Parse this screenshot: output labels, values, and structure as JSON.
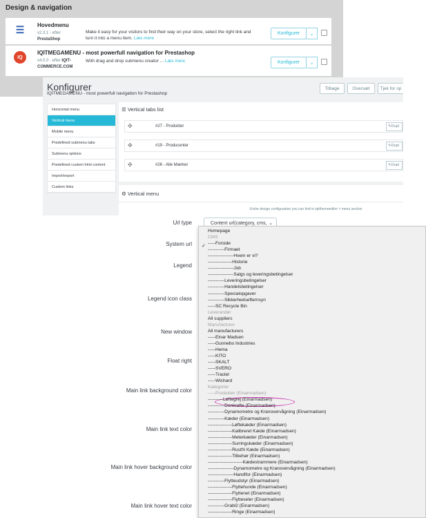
{
  "top_panel": {
    "section_title": "Design & navigation",
    "modules": [
      {
        "name": "Hovedmenu",
        "version": "v2.3.1 - efter",
        "author": "PrestaShop",
        "description": "Make it easy for your visitors to find their way on your store, select the right link and turn it into a menu item.",
        "read_more": "Læs mere",
        "configure": "Konfigurer",
        "icon": "menu-icon"
      },
      {
        "name": "IQITMEGAMENU - most powerfull navigation for Prestashop",
        "version": "v4.0.0 - efter",
        "author": "IQIT-COMMERCE.COM",
        "description": "With drag and drop submenu creator ...",
        "read_more": "Læs mere",
        "configure": "Konfigurer",
        "icon_text": "IQ"
      }
    ]
  },
  "config": {
    "title": "Konfigurer",
    "subtitle": "IQITMEGAMENU - most powerfull navigation for Prestashop",
    "buttons": {
      "back": "Tilbage",
      "translate": "Oversæt",
      "check": "Tjek for op"
    },
    "side_menu": [
      "Horizontal menu",
      "Vertical menu",
      "Mobile menu",
      "Predefined submenu tabs",
      "Submenu options",
      "Predefined custom html content",
      "Import/export",
      "Custom links"
    ],
    "tabs_list_title": "Vertical tabs list",
    "tabs": [
      {
        "label": "#27 - Produkter",
        "dup": "Dupl"
      },
      {
        "label": "#19 - Producenter",
        "dup": "Dupl"
      },
      {
        "label": "#26 - Alle Mærker",
        "dup": "Dupl"
      }
    ],
    "vertical_menu_title": "Vertical menu",
    "note": "Entire design configuration you can find in iqitthemeeditor > menu section"
  },
  "form": {
    "labels": {
      "url_type": "Url type",
      "system_url": "System url",
      "legend": "Legend",
      "legend_icon_class": "Legend icon class",
      "new_window": "New window",
      "float_right": "Float right",
      "main_bg": "Main link background color",
      "main_text": "Main link text color",
      "main_hover_bg": "Main link hover background color",
      "main_hover_text": "Main link hover text color"
    },
    "url_type_value": "Content url(category, cms,"
  },
  "dropdown": {
    "options": [
      {
        "text": "Homepage",
        "group": false
      },
      {
        "text": "CMS",
        "group": true
      },
      {
        "text": "-----Forside",
        "group": false,
        "checked": true
      },
      {
        "text": "-----------Firmaet",
        "group": false
      },
      {
        "text": "-----------------Hvem er vi?",
        "group": false
      },
      {
        "text": "----------------Historie",
        "group": false
      },
      {
        "text": "-----------------Job",
        "group": false
      },
      {
        "text": "-----------------Salgs og leveringsbetingelser",
        "group": false
      },
      {
        "text": "-----------Leveringsbetingelser",
        "group": false
      },
      {
        "text": "-----------Handelsbetingelser",
        "group": false
      },
      {
        "text": "-----------Specialopgaver",
        "group": false
      },
      {
        "text": "-----------Sikkerhedsefternsyn",
        "group": false
      },
      {
        "text": "-----SC Recycle Bin",
        "group": false
      },
      {
        "text": "Leverandør",
        "group": true
      },
      {
        "text": "All suppliers",
        "group": false
      },
      {
        "text": "Manufacturer",
        "group": true
      },
      {
        "text": "All manufacturers",
        "group": false
      },
      {
        "text": "-----Einar Madsen",
        "group": false
      },
      {
        "text": "-----Gunnebo Industries",
        "group": false
      },
      {
        "text": "-----Hema",
        "group": false
      },
      {
        "text": "-----KITO",
        "group": false
      },
      {
        "text": "-----SKALT",
        "group": false
      },
      {
        "text": "-----SVERO",
        "group": false
      },
      {
        "text": "-----Tractel",
        "group": false
      },
      {
        "text": "-----Wichard",
        "group": false
      },
      {
        "text": "Kategorier",
        "group": true
      },
      {
        "text": "-----Produkter (Einarmadsen)",
        "group": true
      },
      {
        "text": "----------Løftegrej (Einarmadsen)",
        "group": false
      },
      {
        "text": "-----------Donkrafte (Einarmadsen)",
        "group": false
      },
      {
        "text": "-----------Dynamometre og Kranovervågning (Einarmadsen)",
        "group": false
      },
      {
        "text": "-----------Kæder (Einarmadsen)",
        "group": false
      },
      {
        "text": "----------------Løftekæder (Einarmadsen)",
        "group": false
      },
      {
        "text": "----------------Kalibreret Kæde (Einarmadsen)",
        "group": false
      },
      {
        "text": "----------------Meterkæder (Einarmadsen)",
        "group": false
      },
      {
        "text": "----------------Surringskæder (Einarmadsen)",
        "group": false
      },
      {
        "text": "----------------Rustfri Kæde (Einarmadsen)",
        "group": false
      },
      {
        "text": "----------------Tilbehør (Einarmadsen)",
        "group": false
      },
      {
        "text": "-----------------------Kædestrammere (Einarmadsen)",
        "group": false
      },
      {
        "text": "-----------------Dynamometre og Kranovervågning (Einarmadsen)",
        "group": false
      },
      {
        "text": "-----------------Handlfor (Einarmadsen)",
        "group": false
      },
      {
        "text": "-----------Flytteudstyr (Einarmadsen)",
        "group": false
      },
      {
        "text": "----------------Flyttehunde (Einarmadsen)",
        "group": false
      },
      {
        "text": "----------------Flyttenet (Einarmadsen)",
        "group": false
      },
      {
        "text": "----------------Flytteseler (Einarmadsen)",
        "group": false
      },
      {
        "text": "-----------Grabl2 (Einarmadsen)",
        "group": false
      },
      {
        "text": "----------------Ringe (Einarmadsen)",
        "group": false
      }
    ]
  },
  "colors": {
    "accent": "#25b9d7",
    "highlight_ring": "#cc2fb0",
    "iqit_red": "#e0452a"
  }
}
